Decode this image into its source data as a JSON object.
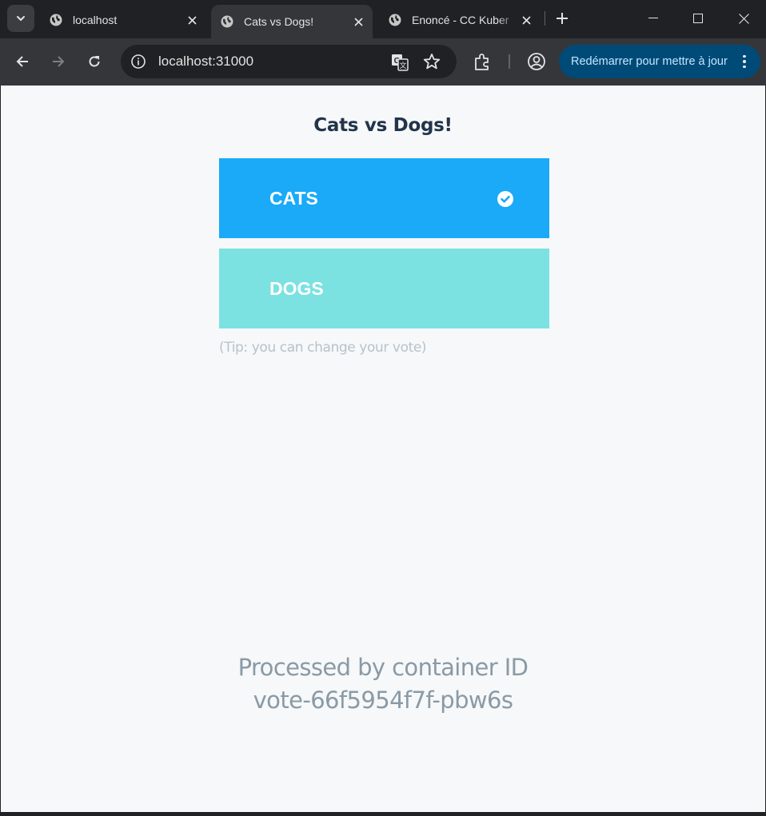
{
  "browser": {
    "tabs": [
      {
        "title": "localhost",
        "icon": "globe-icon",
        "active": false
      },
      {
        "title": "Cats vs Dogs!",
        "icon": "globe-icon",
        "active": true
      },
      {
        "title": "Enoncé - CC Kuber",
        "icon": "globe-icon",
        "active": false
      }
    ],
    "address": "localhost:31000",
    "update_button": "Redémarrer pour mettre à jour",
    "colors": {
      "frame": "#202124",
      "toolbar": "#35363a",
      "active_tab": "#35363a",
      "update_pill": "#004a77"
    }
  },
  "page": {
    "title": "Cats vs Dogs!",
    "options": [
      {
        "label": "CATS",
        "selected": true,
        "color": "#1aaaf8"
      },
      {
        "label": "DOGS",
        "selected": false,
        "color": "#7be2e1"
      }
    ],
    "tip": "(Tip: you can change your vote)",
    "footer_line1": "Processed by container ID",
    "footer_line2": "vote-66f5954f7f-pbw6s",
    "background": "#f6f8f9"
  }
}
